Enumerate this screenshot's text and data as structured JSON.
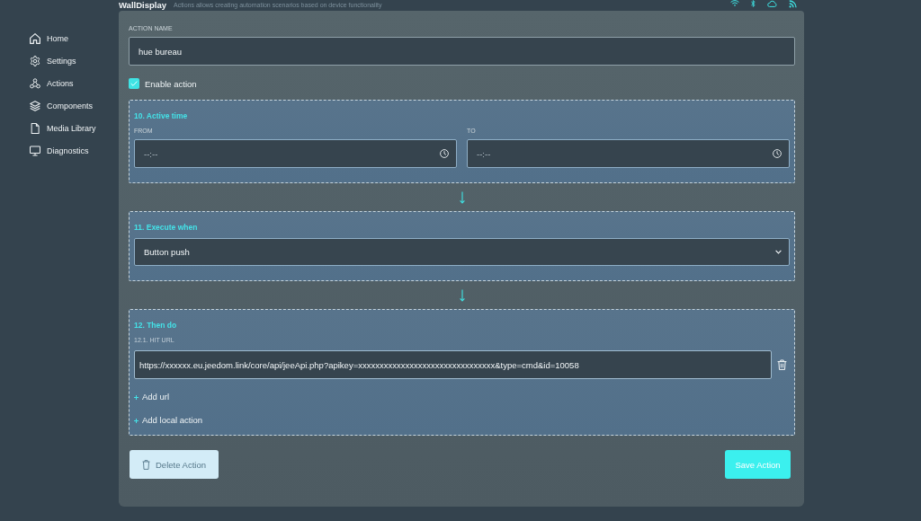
{
  "header": {
    "title": "WallDisplay",
    "subtitle": "Actions allows creating automation scenarios based on device functionality"
  },
  "sidebar": {
    "items": [
      {
        "kind": "home",
        "label": "Home"
      },
      {
        "kind": "settings",
        "label": "Settings"
      },
      {
        "kind": "actions",
        "label": "Actions"
      },
      {
        "kind": "components",
        "label": "Components"
      },
      {
        "kind": "media",
        "label": "Media Library"
      },
      {
        "kind": "diagnostics",
        "label": "Diagnostics"
      }
    ]
  },
  "form": {
    "action_name": {
      "label": "ACTION NAME",
      "value": "hue bureau"
    },
    "enable": {
      "label": "Enable action",
      "checked": true
    },
    "steps": [
      {
        "kind": "time",
        "title": "10. Active time",
        "fields": [
          {
            "label": "FROM",
            "placeholder": "--:--"
          },
          {
            "label": "TO",
            "placeholder": "--:--"
          }
        ]
      },
      {
        "kind": "trigger",
        "title": "11. Execute when",
        "value": "Button push"
      },
      {
        "kind": "actions",
        "title": "12. Then do",
        "urls": [
          {
            "label": "12.1. HIT URL",
            "value": "https://xxxxxx.eu.jeedom.link/core/api/jeeApi.php?apikey=xxxxxxxxxxxxxxxxxxxxxxxxxxxxxxxx&type=cmd&id=10058"
          }
        ],
        "links": [
          {
            "label": "Add url"
          },
          {
            "label": "Add local action"
          }
        ]
      }
    ],
    "buttons": [
      {
        "kind": "delete",
        "label": "Delete Action"
      },
      {
        "kind": "save",
        "label": "Save Action"
      }
    ]
  }
}
